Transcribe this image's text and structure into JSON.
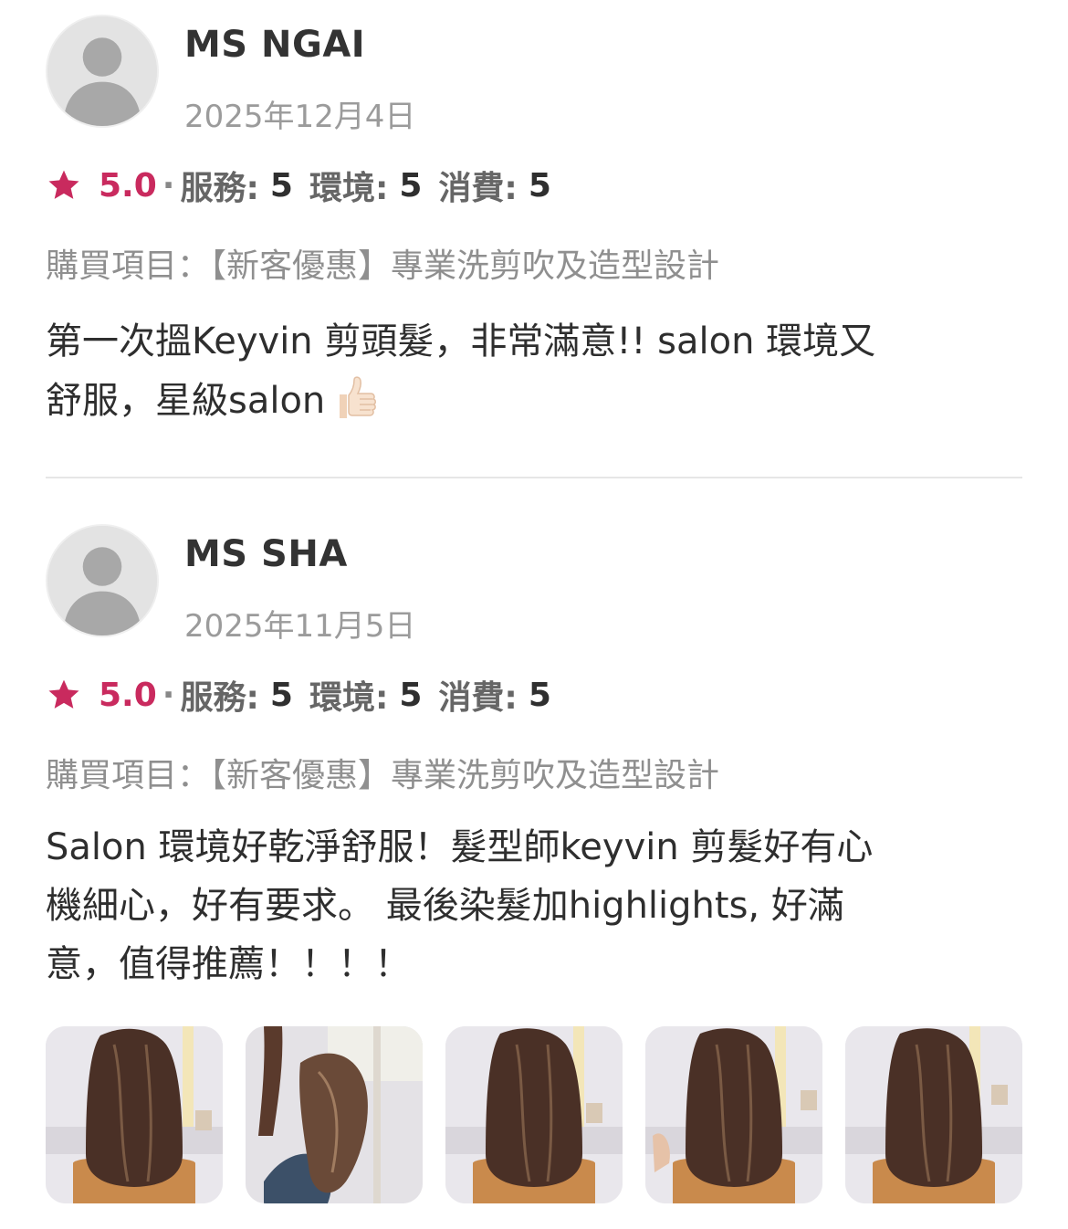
{
  "reviews": [
    {
      "reviewer": "MS NGAI",
      "date": "2025年12月4日",
      "rating": "5.0",
      "separator": "·",
      "service_label": "服務:",
      "service_value": "5",
      "environment_label": "環境:",
      "environment_value": "5",
      "spending_label": "消費:",
      "spending_value": "5",
      "purchase_label": "購買項目：",
      "purchase_item": "【新客優惠】專業洗剪吹及造型設計",
      "text_line1": "第一次搵Keyvin 剪頭髮，非常滿意!! salon 環境又",
      "text_line2": "舒服，星級salon",
      "emoji": "thumbs-up-icon"
    },
    {
      "reviewer": "MS SHA",
      "date": "2025年11月5日",
      "rating": "5.0",
      "separator": "·",
      "service_label": "服務:",
      "service_value": "5",
      "environment_label": "環境:",
      "environment_value": "5",
      "spending_label": "消費:",
      "spending_value": "5",
      "purchase_label": "購買項目：",
      "purchase_item": "【新客優惠】專業洗剪吹及造型設計",
      "text_line1": "Salon 環境好乾淨舒服！髮型師keyvin 剪髮好有心",
      "text_line2": "機細心，好有要求。 最後染髮加highlights, 好滿",
      "text_line3": "意，值得推薦！！！！",
      "photos": [
        "hair-photo-1",
        "hair-photo-2",
        "hair-photo-3",
        "hair-photo-4",
        "hair-photo-5"
      ]
    }
  ],
  "colors": {
    "accent": "#c92a5e",
    "date_gray": "#9b9b9b",
    "divider": "#e6e6e6"
  }
}
